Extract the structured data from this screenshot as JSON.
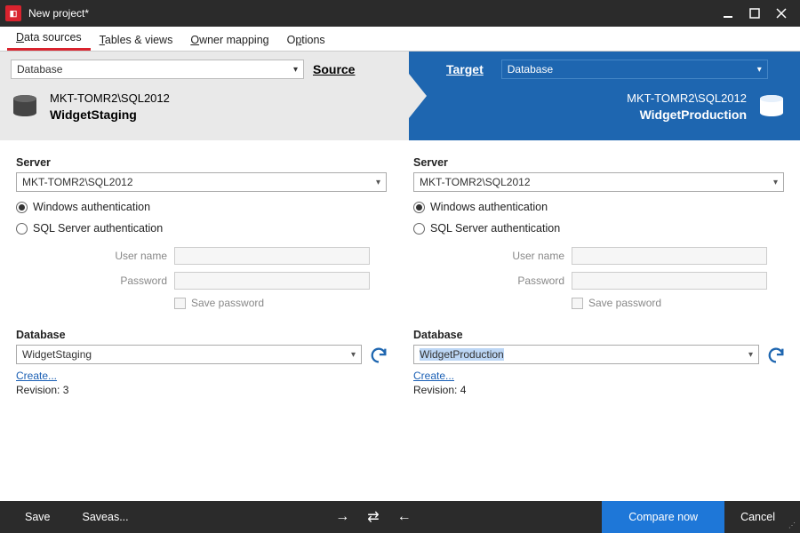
{
  "window": {
    "title": "New project*"
  },
  "tabs": {
    "data_sources": "Data sources",
    "tables_views": "Tables & views",
    "owner_mapping": "Owner mapping",
    "options": "Options"
  },
  "header": {
    "source_label": "Source",
    "target_label": "Target",
    "type_dropdown": "Database",
    "source": {
      "server": "MKT-TOMR2\\SQL2012",
      "database": "WidgetStaging"
    },
    "target": {
      "server": "MKT-TOMR2\\SQL2012",
      "database": "WidgetProduction"
    }
  },
  "form": {
    "server_label": "Server",
    "auth_windows": "Windows authentication",
    "auth_sql": "SQL Server authentication",
    "username_label": "User name",
    "password_label": "Password",
    "save_password": "Save password",
    "database_label": "Database",
    "create_link": "Create...",
    "revision_label": "Revision:"
  },
  "source_panel": {
    "server_value": "MKT-TOMR2\\SQL2012",
    "auth_selected": "windows",
    "database_value": "WidgetStaging",
    "revision": "3"
  },
  "target_panel": {
    "server_value": "MKT-TOMR2\\SQL2012",
    "auth_selected": "windows",
    "database_value": "WidgetProduction",
    "revision": "4"
  },
  "footer": {
    "save": "Save",
    "save_as": "Save as...",
    "compare": "Compare now",
    "cancel": "Cancel"
  }
}
